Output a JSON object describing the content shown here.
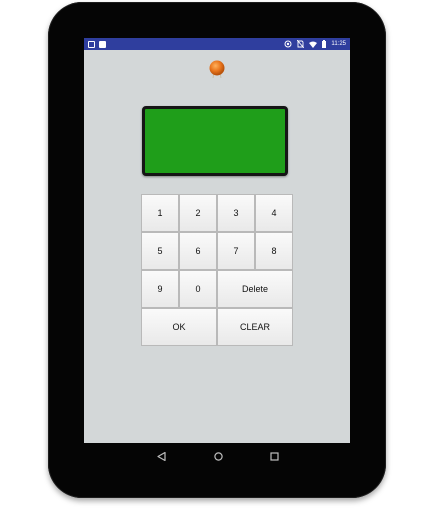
{
  "status_bar": {
    "time": "11:25",
    "left_icons": [
      "app-icon",
      "notification-icon"
    ],
    "right_icons": [
      "cast-icon",
      "no-sim-icon",
      "wifi-icon",
      "battery-icon"
    ]
  },
  "display": {
    "value": "",
    "color": "#1f9e1a"
  },
  "led": {
    "color": "#e8741c"
  },
  "keypad": {
    "keys": [
      {
        "label": "1"
      },
      {
        "label": "2"
      },
      {
        "label": "3"
      },
      {
        "label": "4"
      },
      {
        "label": "5"
      },
      {
        "label": "6"
      },
      {
        "label": "7"
      },
      {
        "label": "8"
      },
      {
        "label": "9"
      },
      {
        "label": "0"
      },
      {
        "label": "Delete"
      },
      {
        "label": "OK"
      },
      {
        "label": "CLEAR"
      }
    ]
  },
  "nav_bar": {
    "icons": [
      "back-icon",
      "home-icon",
      "recents-icon"
    ]
  }
}
